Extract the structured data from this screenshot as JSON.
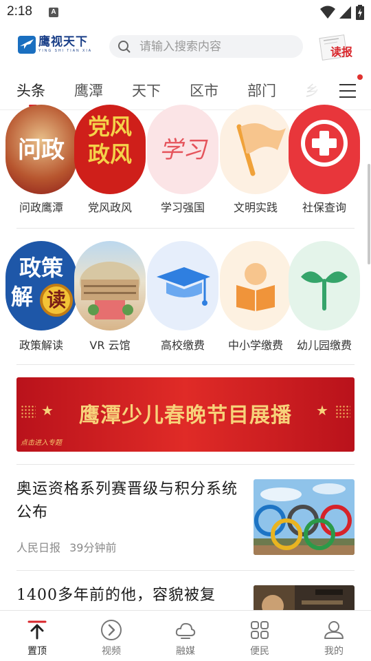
{
  "status_bar": {
    "time": "2:18",
    "notification_letter": "A"
  },
  "header": {
    "logo": {
      "name": "鹰视天下",
      "pinyin": "YING SHI TIAN XIA"
    },
    "search": {
      "placeholder": "请输入搜索内容"
    },
    "read_paper": {
      "label": "读报"
    }
  },
  "tabs": {
    "items": [
      {
        "label": "头条",
        "active": true
      },
      {
        "label": "鹰潭"
      },
      {
        "label": "天下"
      },
      {
        "label": "区市"
      },
      {
        "label": "部门"
      },
      {
        "label": "乡"
      }
    ]
  },
  "grid_row_1": {
    "items": [
      {
        "label": "问政鹰潭",
        "art": "问政"
      },
      {
        "label": "党风政风",
        "art_line1": "党风",
        "art_line2": "政风"
      },
      {
        "label": "学习强国",
        "art": "学习"
      },
      {
        "label": "文明实践"
      },
      {
        "label": "社保查询"
      }
    ]
  },
  "grid_row_2": {
    "items": [
      {
        "label": "政策解读",
        "art_line1": "政策",
        "art_line2": "解",
        "art_badge": "读"
      },
      {
        "label": "VR 云馆"
      },
      {
        "label": "高校缴费"
      },
      {
        "label": "中小学缴费"
      },
      {
        "label": "幼儿园缴费"
      }
    ]
  },
  "banner": {
    "title": "鹰潭少儿春晚节目展播",
    "subtitle": "点击进入专题",
    "colors": {
      "background": "#d42322",
      "text": "#f7d27a"
    }
  },
  "news": [
    {
      "title": "奥运资格系列赛晋级与积分系统公布",
      "source": "人民日报",
      "time": "39分钟前"
    },
    {
      "title": "1400多年前的他，容貌被复"
    }
  ],
  "bottom_nav": {
    "items": [
      {
        "label": "置顶",
        "icon": "top-arrow-icon",
        "active": true
      },
      {
        "label": "视频",
        "icon": "play-circle-icon"
      },
      {
        "label": "融媒",
        "icon": "cloud-icon"
      },
      {
        "label": "便民",
        "icon": "grid-icon"
      },
      {
        "label": "我的",
        "icon": "user-icon"
      }
    ]
  },
  "colors": {
    "accent": "#d9262b",
    "brand_blue": "#1a6fc0"
  }
}
